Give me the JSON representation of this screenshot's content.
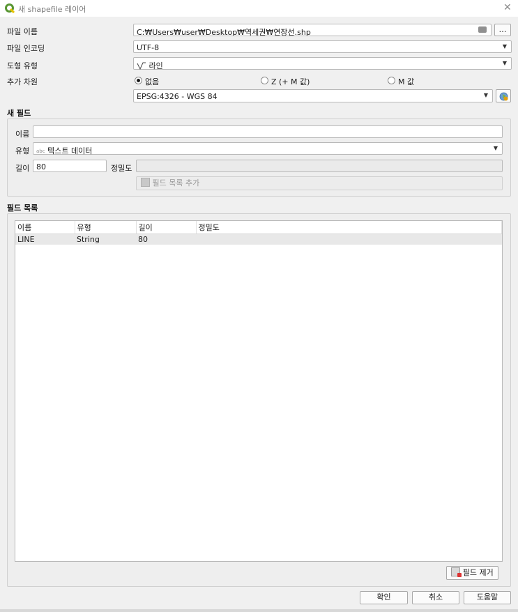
{
  "window": {
    "title": "새 shapefile 레이어",
    "close": "✕"
  },
  "form": {
    "file_name_label": "파일 이름",
    "file_name_value": "C:₩Users₩user₩Desktop₩역세권₩연장선.shp",
    "browse_label": "…",
    "encoding_label": "파일 인코딩",
    "encoding_value": "UTF-8",
    "geometry_label": "도형 유형",
    "geometry_value": "라인",
    "dimensions_label": "추가 차원",
    "dim_options": [
      "없음",
      "Z (+ M 값)",
      "M 값"
    ],
    "crs_value": "EPSG:4326 - WGS 84"
  },
  "new_field": {
    "group_title": "새 필드",
    "name_label": "이름",
    "name_value": "",
    "type_label": "유형",
    "type_tag": "abc",
    "type_value": "텍스트 데이터",
    "length_label": "길이",
    "length_value": "80",
    "precision_label": "정밀도",
    "precision_value": "",
    "add_button": "필드 목록 추가"
  },
  "field_list": {
    "group_title": "필드 목록",
    "columns": [
      "이름",
      "유형",
      "길이",
      "정밀도"
    ],
    "rows": [
      [
        "LINE",
        "String",
        "80",
        ""
      ]
    ],
    "remove_button": "필드 제거"
  },
  "buttons": {
    "ok": "확인",
    "cancel": "취소",
    "help": "도움말"
  },
  "colors": {
    "logo": "#589632",
    "accent_globe": "#e0a010"
  }
}
